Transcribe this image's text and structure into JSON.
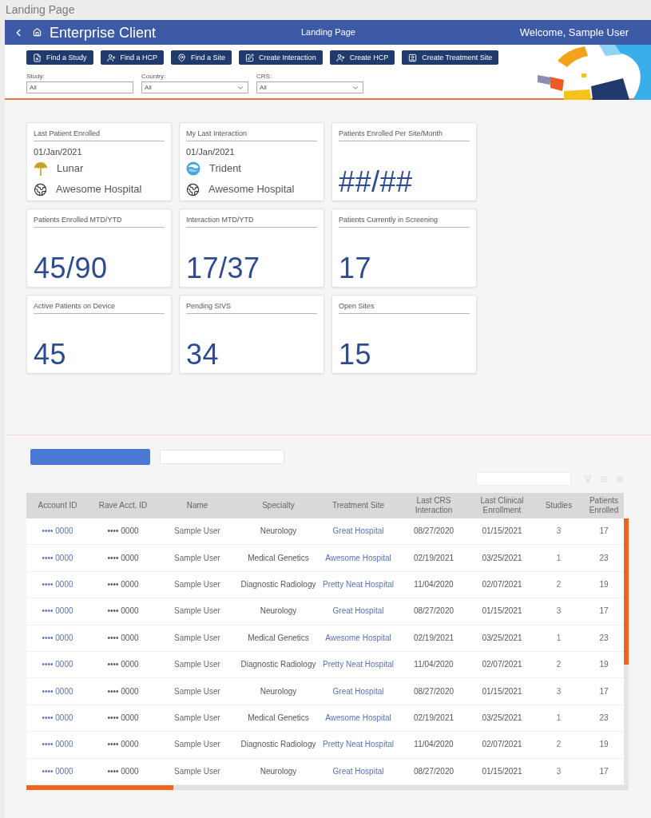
{
  "frame_title": "Landing Page",
  "header": {
    "title": "Enterprise Client",
    "page_title": "Landing Page",
    "welcome": "Welcome, Sample User"
  },
  "toolbar": {
    "buttons": [
      "Find a Study",
      "Find a HCP",
      "Find a Site",
      "Create Interaction",
      "Create HCP",
      "Create Treatment Site"
    ]
  },
  "filters": [
    {
      "label": "Study:",
      "value": "All",
      "kind": "text"
    },
    {
      "label": "Country:",
      "value": "All",
      "kind": "select"
    },
    {
      "label": "CRS:",
      "value": "All",
      "kind": "select"
    }
  ],
  "cards": [
    {
      "kind": "detail",
      "title": "Last Patient Enrolled",
      "date": "01/Jan/2021",
      "lines": [
        {
          "kind": "study",
          "text": "Lunar"
        },
        {
          "kind": "site",
          "text": "Awesome Hospital"
        }
      ]
    },
    {
      "kind": "detail",
      "title": "My Last Interaction",
      "date": "01/Jan/2021",
      "lines": [
        {
          "kind": "study",
          "text": "Trident"
        },
        {
          "kind": "site",
          "text": "Awesome Hospital"
        }
      ]
    },
    {
      "kind": "metric",
      "title": "Patients Enrolled Per Site/Month",
      "value": "##/##"
    },
    {
      "kind": "metric",
      "title": "Patients Enrolled MTD/YTD",
      "value": "45/90"
    },
    {
      "kind": "metric",
      "title": "Interaction MTD/YTD",
      "value": "17/37"
    },
    {
      "kind": "metric",
      "title": "Patients Currently in Screening",
      "value": "17"
    },
    {
      "kind": "metric",
      "title": "Active Patients on Device",
      "value": "45"
    },
    {
      "kind": "metric",
      "title": "Pending SIVS",
      "value": "34"
    },
    {
      "kind": "metric",
      "title": "Open Sites",
      "value": "15"
    }
  ],
  "table": {
    "columns": [
      "Account ID",
      "Rave Acct. ID",
      "Name",
      "Specialty",
      "Treatment Site",
      "Last CRS Interaction",
      "Last Clinical Enrollment",
      "Studies",
      "Patients Enrolled"
    ],
    "rows": [
      [
        "•••• 0000",
        "•••• 0000",
        "Sample User",
        "Neurology",
        "Great Hospital",
        "08/27/2020",
        "01/15/2021",
        "3",
        "17"
      ],
      [
        "•••• 0000",
        "•••• 0000",
        "Sample User",
        "Medical Genetics",
        "Awesome Hospital",
        "02/19/2021",
        "03/25/2021",
        "1",
        "23"
      ],
      [
        "•••• 0000",
        "•••• 0000",
        "Sample User",
        "Diagnostic Radiology",
        "Pretty Neat Hospital",
        "11/04/2020",
        "02/07/2021",
        "2",
        "19"
      ],
      [
        "•••• 0000",
        "•••• 0000",
        "Sample User",
        "Neurology",
        "Great Hospital",
        "08/27/2020",
        "01/15/2021",
        "3",
        "17"
      ],
      [
        "•••• 0000",
        "•••• 0000",
        "Sample User",
        "Medical Genetics",
        "Awesome Hospital",
        "02/19/2021",
        "03/25/2021",
        "1",
        "23"
      ],
      [
        "•••• 0000",
        "•••• 0000",
        "Sample User",
        "Diagnostic Radiology",
        "Pretty Neat Hospital",
        "11/04/2020",
        "02/07/2021",
        "2",
        "19"
      ],
      [
        "•••• 0000",
        "•••• 0000",
        "Sample User",
        "Neurology",
        "Great Hospital",
        "08/27/2020",
        "01/15/2021",
        "3",
        "17"
      ],
      [
        "•••• 0000",
        "•••• 0000",
        "Sample User",
        "Medical Genetics",
        "Awesome Hospital",
        "02/19/2021",
        "03/25/2021",
        "1",
        "23"
      ],
      [
        "•••• 0000",
        "•••• 0000",
        "Sample User",
        "Diagnostic Radiology",
        "Pretty Neat Hospital",
        "11/04/2020",
        "02/07/2021",
        "2",
        "19"
      ],
      [
        "•••• 0000",
        "•••• 0000",
        "Sample User",
        "Neurology",
        "Great Hospital",
        "08/27/2020",
        "01/15/2021",
        "3",
        "17"
      ]
    ]
  }
}
